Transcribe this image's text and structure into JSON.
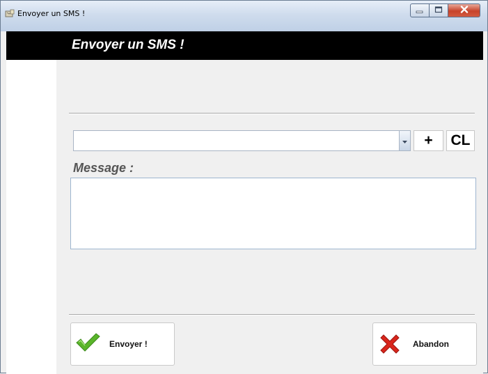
{
  "window": {
    "title": "Envoyer un SMS !",
    "icons": {
      "app": "sms-app-icon",
      "minimize": "minimize-icon",
      "maximize": "maximize-icon",
      "close": "close-icon"
    }
  },
  "header": {
    "title": "Envoyer un SMS !"
  },
  "recipient": {
    "value": "",
    "add_label": "+",
    "clear_label": "CL",
    "dropdown_icon": "chevron-down-icon"
  },
  "message": {
    "label": "Message :",
    "value": ""
  },
  "actions": {
    "send_label": "Envoyer !",
    "send_icon": "checkmark-icon",
    "cancel_label": "Abandon",
    "cancel_icon": "red-x-icon"
  },
  "colors": {
    "header_bg": "#000000",
    "check_green": "#5ab52a",
    "cancel_red": "#d9261c"
  }
}
